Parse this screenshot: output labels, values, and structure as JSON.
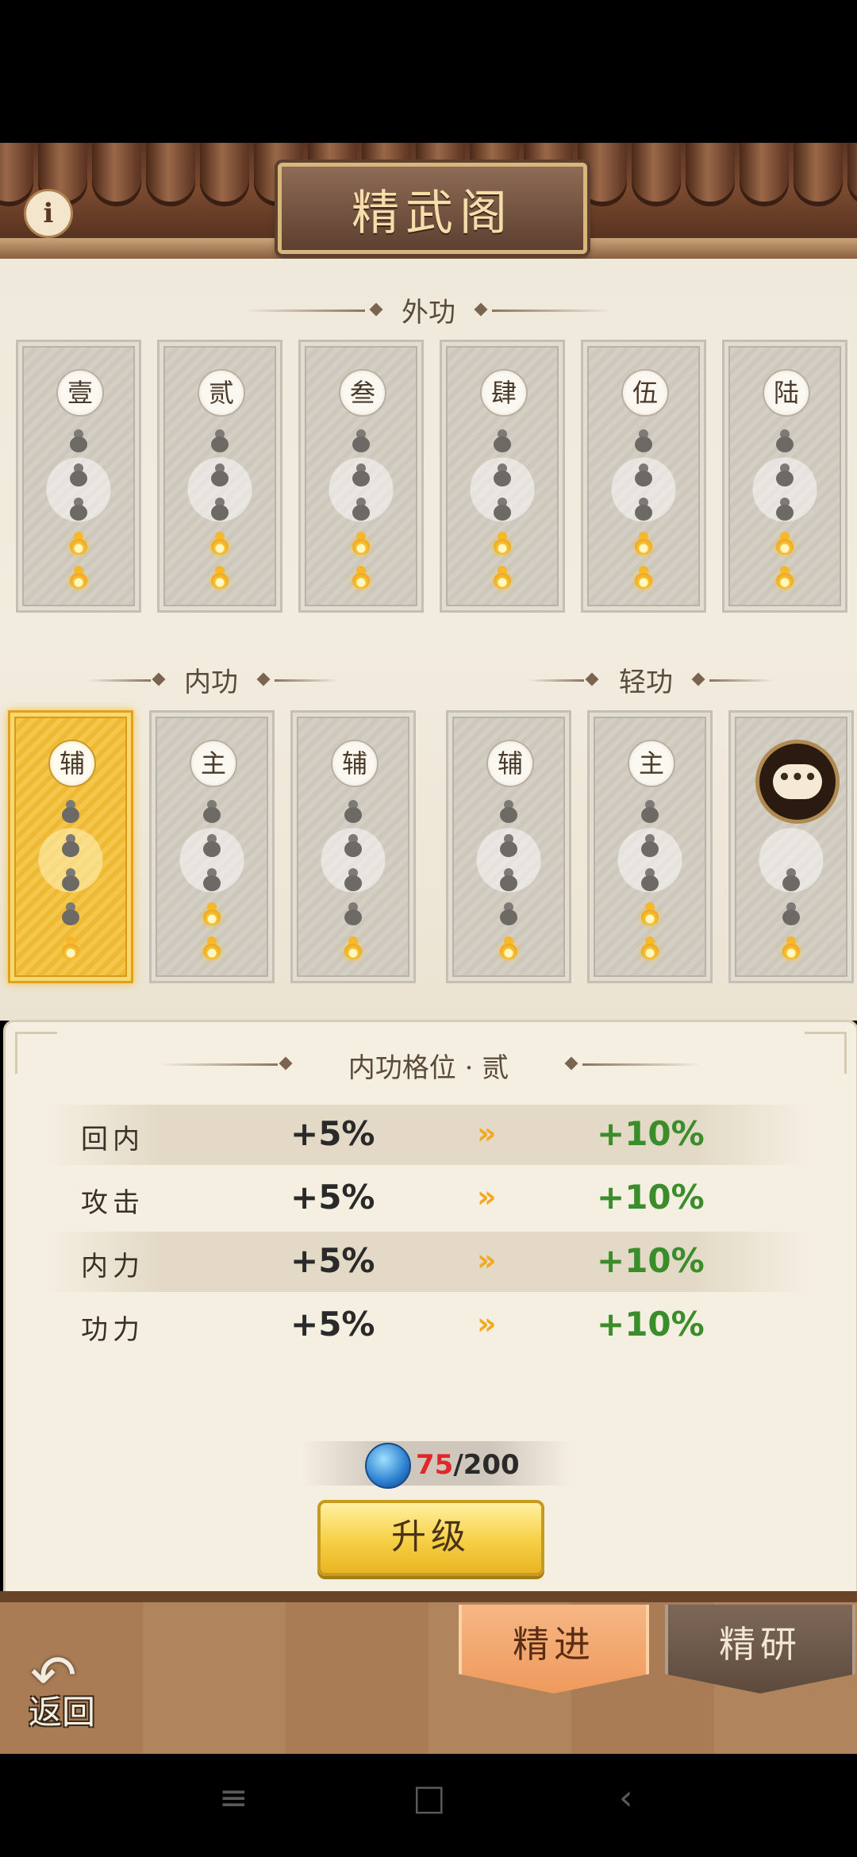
{
  "header": {
    "title": "精武阁",
    "info_icon": "i"
  },
  "waigong": {
    "title": "外功",
    "slots": [
      {
        "label": "壹",
        "lit": 2
      },
      {
        "label": "贰",
        "lit": 2
      },
      {
        "label": "叁",
        "lit": 2
      },
      {
        "label": "肆",
        "lit": 2
      },
      {
        "label": "伍",
        "lit": 2
      },
      {
        "label": "陆",
        "lit": 2
      }
    ]
  },
  "neigong": {
    "title": "内功",
    "slots": [
      {
        "label": "辅",
        "lit": 1,
        "active": true
      },
      {
        "label": "主",
        "lit": 2
      },
      {
        "label": "辅",
        "lit": 1
      }
    ]
  },
  "qinggong": {
    "title": "轻功",
    "slots": [
      {
        "label": "辅",
        "lit": 1
      },
      {
        "label": "主",
        "lit": 2
      },
      {
        "label": "",
        "lit": 1,
        "chat": true
      }
    ]
  },
  "panel": {
    "title": "内功格位 · 贰",
    "stats": [
      {
        "name": "回内",
        "from": "+5%",
        "to": "+10%"
      },
      {
        "name": "攻击",
        "from": "+5%",
        "to": "+10%"
      },
      {
        "name": "内力",
        "from": "+5%",
        "to": "+10%"
      },
      {
        "name": "功力",
        "from": "+5%",
        "to": "+10%"
      }
    ],
    "cost_current": "75",
    "cost_total": "/200",
    "upgrade_label": "升级",
    "arrow_glyph": "»"
  },
  "chat_icon_text": "•••",
  "footer": {
    "back_label": "返回",
    "tabs": [
      "精进",
      "精研"
    ]
  },
  "navbar": {
    "menu": "≡",
    "home": "□",
    "back": "‹"
  },
  "colors": {
    "active_card": "#f4c64a",
    "gain_green": "#3b8d2c",
    "cost_red": "#e2262b",
    "roof_brown": "#5a3523"
  }
}
